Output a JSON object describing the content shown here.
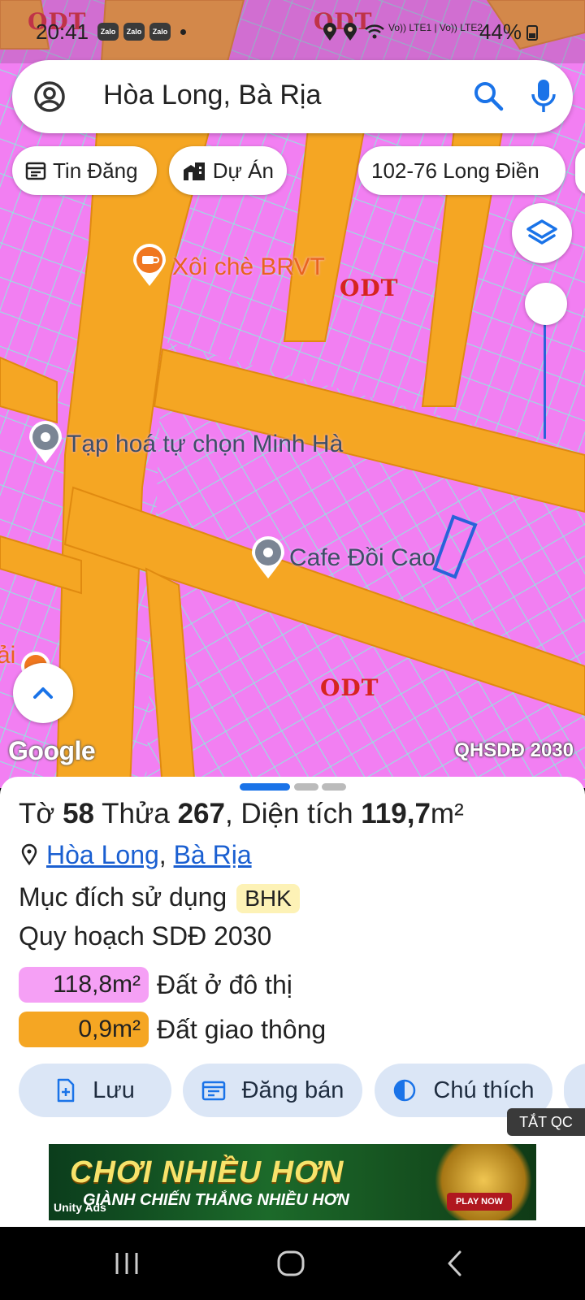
{
  "status_bar": {
    "time": "20:41",
    "notification_apps": [
      "Zalo",
      "Zalo",
      "Zalo"
    ],
    "network": "Vo)) LTE1 | Vo)) LTE2",
    "battery": "44%"
  },
  "search": {
    "query": "Hòa Long, Bà Rịa"
  },
  "chips": [
    {
      "label": "Tin Đăng",
      "icon": "calendar-icon"
    },
    {
      "label": "Dự Án",
      "icon": "buildings-icon"
    },
    {
      "label": "102-76 Long Điền",
      "icon": ""
    }
  ],
  "map": {
    "zone_labels": [
      "ODT",
      "ODT",
      "ODT",
      "ODT"
    ],
    "pois": [
      {
        "label": "Xôi chè BRVT",
        "type": "food"
      },
      {
        "label": "Tạp hoá tự chọn Minh Hà",
        "type": "shop"
      },
      {
        "label": "Cafe Đồi Cao",
        "type": "shop"
      },
      {
        "label": "ải",
        "type": "food"
      }
    ],
    "logo": "Google",
    "overlay_tag": "QHSDĐ 2030",
    "colors": {
      "residential": "#f27ff2",
      "road": "#f5a623",
      "parcel_line": "#7fe0d8",
      "selection": "#2962d9"
    }
  },
  "parcel": {
    "title_prefix": "Tờ ",
    "sheet_no": "58",
    "parcel_label": " Thửa ",
    "parcel_no": "267",
    "area_label": ", Diện tích ",
    "area": "119,7",
    "area_unit": "m²",
    "ward": "Hòa Long",
    "separator": ",",
    "city": "Bà Rịa",
    "purpose_label": "Mục đích sử dụng",
    "purpose_code": "BHK",
    "plan_label": "Quy hoạch SDĐ 2030",
    "legend": [
      {
        "value": "118,8m²",
        "label": "Đất ở đô thị",
        "color": "#f5a0f5"
      },
      {
        "value": "0,9m²",
        "label": "Đất giao thông",
        "color": "#f5a623"
      }
    ]
  },
  "actions": [
    {
      "label": "Lưu",
      "icon": "save-file-icon"
    },
    {
      "label": "Đăng bán",
      "icon": "listing-icon"
    },
    {
      "label": "Chú thích",
      "icon": "contrast-icon"
    }
  ],
  "ads": {
    "close_label": "TẮT QC",
    "headline": "CHƠI NHIỀU HƠN",
    "subline": "GIÀNH CHIẾN THẮNG NHIỀU HƠN",
    "brand": "Unity Ads",
    "cta": "PLAY NOW"
  }
}
